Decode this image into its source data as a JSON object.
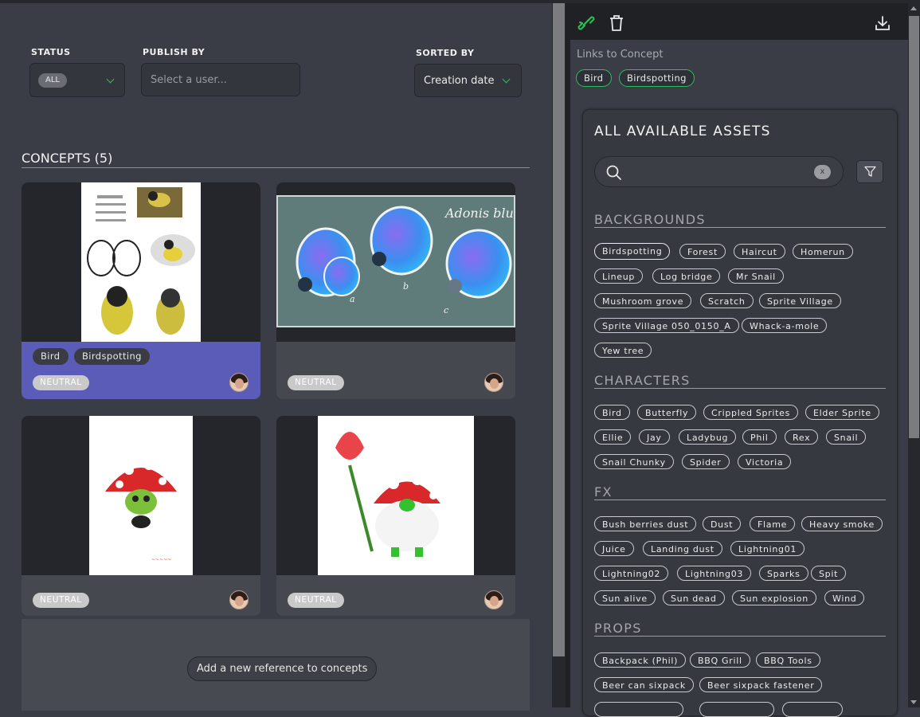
{
  "filters": {
    "status": {
      "label": "STATUS",
      "value": "ALL"
    },
    "publish_by": {
      "label": "PUBLISH BY",
      "placeholder": "Select a user..."
    },
    "sorted_by": {
      "label": "SORTED BY",
      "value": "Creation date"
    }
  },
  "concepts": {
    "title": "CONCEPTS (5)",
    "cards": [
      {
        "status": "NEUTRAL",
        "tags": [
          "Bird",
          "Birdspotting"
        ],
        "image": "british-tits-sketches",
        "highlight_color": "#5b5bb8"
      },
      {
        "status": "NEUTRAL",
        "tags": [],
        "image": "adonis-blue-butterflies",
        "image_caption": "Adonis blue",
        "labels": [
          "a",
          "b",
          "c"
        ]
      },
      {
        "status": "NEUTRAL",
        "tags": [],
        "image": "mushroom-creature"
      },
      {
        "status": "NEUTRAL",
        "tags": [],
        "image": "rose-mushroom-character"
      }
    ],
    "add_button": "Add a new reference to concepts"
  },
  "toolbar": {
    "icons": [
      "link-icon",
      "trash-icon",
      "download-icon"
    ],
    "accent": "#2fbf5a"
  },
  "links": {
    "label": "Links to Concept",
    "tags": [
      "Bird",
      "Birdspotting"
    ]
  },
  "assets": {
    "title": "ALL AVAILABLE ASSETS",
    "search_clear": "x",
    "categories": [
      {
        "name": "BACKGROUNDS",
        "items": [
          "Birdspotting",
          "Forest",
          "Haircut",
          "Homerun",
          "Lineup",
          "Log bridge",
          "Mr Snail",
          "Mushroom grove",
          "Scratch",
          "Sprite Village",
          "Sprite Village 050_0150_A",
          "Whack-a-mole",
          "Yew tree"
        ]
      },
      {
        "name": "CHARACTERS",
        "items": [
          "Bird",
          "Butterfly",
          "Crippled Sprites",
          "Elder Sprite",
          "Ellie",
          "Jay",
          "Ladybug",
          "Phil",
          "Rex",
          "Snail",
          "Snail Chunky",
          "Spider",
          "Victoria"
        ]
      },
      {
        "name": "FX",
        "items": [
          "Bush berries dust",
          "Dust",
          "Flame",
          "Heavy smoke",
          "Juice",
          "Landing dust",
          "Lightning01",
          "Lightning02",
          "Lightning03",
          "Sparks",
          "Spit",
          "Sun alive",
          "Sun dead",
          "Sun explosion",
          "Wind"
        ]
      },
      {
        "name": "PROPS",
        "items": [
          "Backpack (Phil)",
          "BBQ Grill",
          "BBQ Tools",
          "Beer can sixpack",
          "Beer sixpack fastener"
        ]
      }
    ]
  }
}
